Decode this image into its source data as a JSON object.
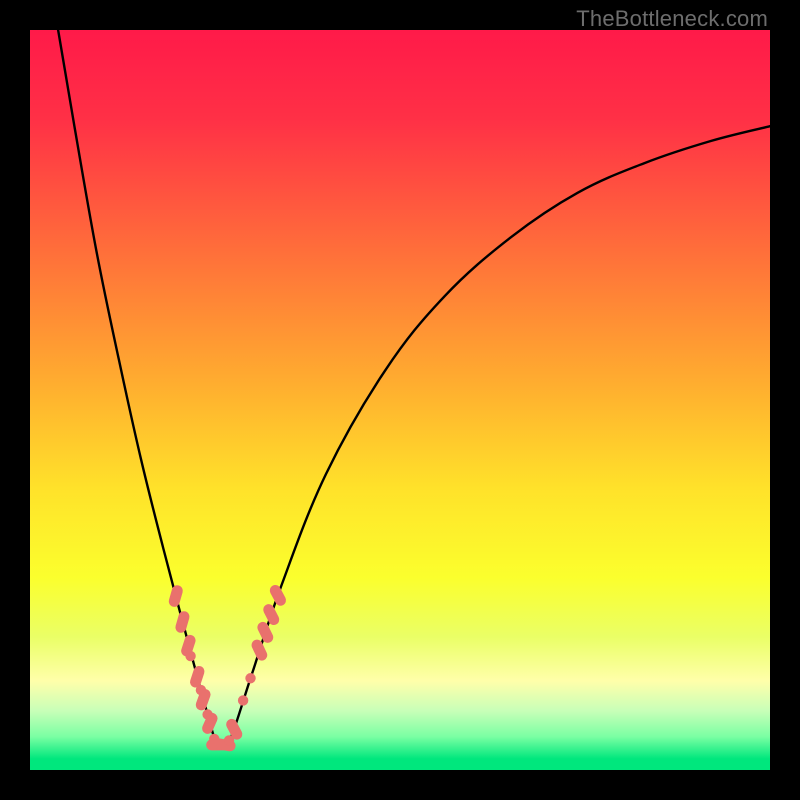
{
  "watermark": "TheBottleneck.com",
  "colors": {
    "frame": "#000000",
    "gradient_stops": [
      {
        "offset": 0.0,
        "color": "#ff1a49"
      },
      {
        "offset": 0.12,
        "color": "#ff3046"
      },
      {
        "offset": 0.3,
        "color": "#ff6f3a"
      },
      {
        "offset": 0.48,
        "color": "#ffae2f"
      },
      {
        "offset": 0.62,
        "color": "#ffe22a"
      },
      {
        "offset": 0.74,
        "color": "#fbff2d"
      },
      {
        "offset": 0.82,
        "color": "#eaff66"
      },
      {
        "offset": 0.88,
        "color": "#ffffaa"
      },
      {
        "offset": 0.92,
        "color": "#c8ffb8"
      },
      {
        "offset": 0.955,
        "color": "#7affa3"
      },
      {
        "offset": 0.985,
        "color": "#00e77d"
      },
      {
        "offset": 1.0,
        "color": "#00e77d"
      }
    ],
    "curve": "#000000",
    "marker_fill": "#e9716d",
    "marker_stroke": "#c94f4b"
  },
  "chart_data": {
    "type": "line",
    "title": "",
    "xlabel": "",
    "ylabel": "",
    "xlim": [
      0,
      1
    ],
    "ylim": [
      0,
      1
    ],
    "grid": false,
    "notes": "Normalized coordinates (0,0)=bottom-left of gradient area, (1,1)=top-right. Single continuous curve with a sharp V near x≈0.25; local minimum y≈0.03 at x≈0.25. Left branch falls steeply from top-left; right branch rises with decreasing slope toward upper right. Markers highlight points near the valley on both branches.",
    "series": [
      {
        "name": "curve",
        "x": [
          0.038,
          0.06,
          0.09,
          0.12,
          0.15,
          0.18,
          0.205,
          0.225,
          0.24,
          0.252,
          0.26,
          0.272,
          0.3,
          0.34,
          0.4,
          0.48,
          0.56,
          0.65,
          0.74,
          0.83,
          0.92,
          1.0
        ],
        "y": [
          1.0,
          0.87,
          0.7,
          0.555,
          0.42,
          0.3,
          0.205,
          0.13,
          0.075,
          0.035,
          0.03,
          0.045,
          0.13,
          0.25,
          0.4,
          0.54,
          0.64,
          0.72,
          0.78,
          0.82,
          0.85,
          0.87
        ]
      }
    ],
    "markers": [
      {
        "x": 0.197,
        "y": 0.235,
        "shape": "capsule",
        "angle": -74
      },
      {
        "x": 0.206,
        "y": 0.2,
        "shape": "capsule",
        "angle": -74
      },
      {
        "x": 0.214,
        "y": 0.168,
        "shape": "capsule",
        "angle": -72
      },
      {
        "x": 0.217,
        "y": 0.154,
        "shape": "circle"
      },
      {
        "x": 0.226,
        "y": 0.126,
        "shape": "capsule",
        "angle": -72
      },
      {
        "x": 0.231,
        "y": 0.108,
        "shape": "circle"
      },
      {
        "x": 0.234,
        "y": 0.095,
        "shape": "capsule",
        "angle": -70
      },
      {
        "x": 0.24,
        "y": 0.075,
        "shape": "circle"
      },
      {
        "x": 0.243,
        "y": 0.063,
        "shape": "capsule",
        "angle": -66
      },
      {
        "x": 0.249,
        "y": 0.042,
        "shape": "circle"
      },
      {
        "x": 0.253,
        "y": 0.034,
        "shape": "capsule",
        "angle": 0
      },
      {
        "x": 0.263,
        "y": 0.034,
        "shape": "capsule",
        "angle": 10
      },
      {
        "x": 0.269,
        "y": 0.04,
        "shape": "circle"
      },
      {
        "x": 0.276,
        "y": 0.055,
        "shape": "capsule",
        "angle": 62
      },
      {
        "x": 0.288,
        "y": 0.094,
        "shape": "circle"
      },
      {
        "x": 0.298,
        "y": 0.124,
        "shape": "circle"
      },
      {
        "x": 0.31,
        "y": 0.162,
        "shape": "capsule",
        "angle": 65
      },
      {
        "x": 0.318,
        "y": 0.186,
        "shape": "capsule",
        "angle": 64
      },
      {
        "x": 0.326,
        "y": 0.21,
        "shape": "capsule",
        "angle": 63
      },
      {
        "x": 0.335,
        "y": 0.236,
        "shape": "capsule",
        "angle": 62
      }
    ]
  }
}
